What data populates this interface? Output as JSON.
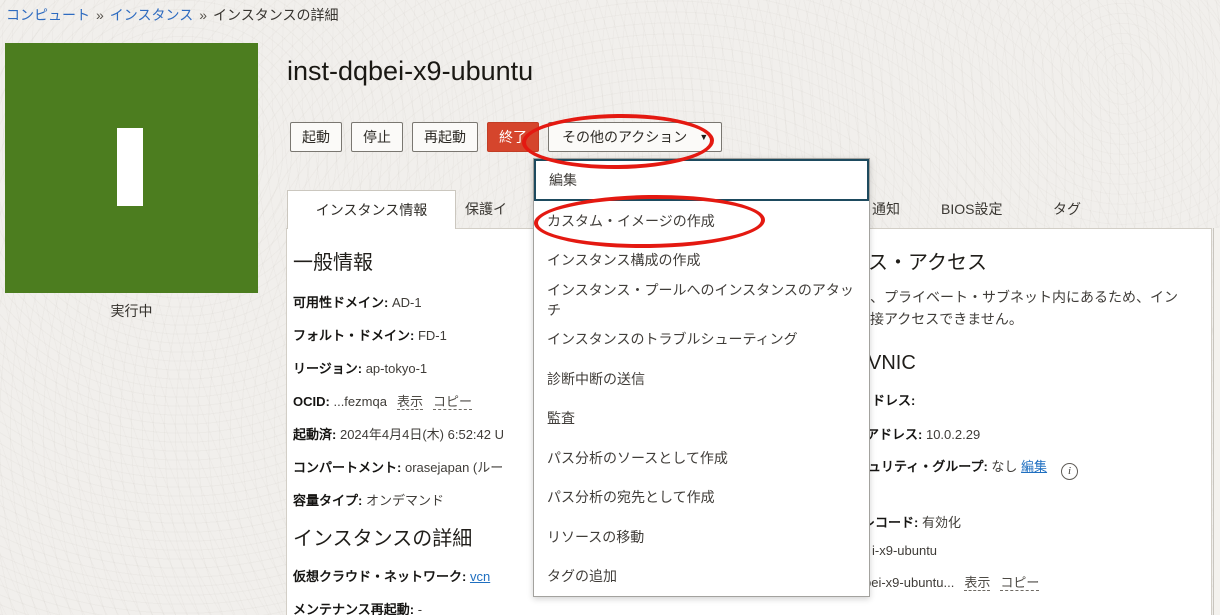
{
  "colors": {
    "background": "#f1efec",
    "status_running_green": "#4c7d1f",
    "danger_red": "#d5452c",
    "annotation_red": "#e41911",
    "link_blue": "#1f6fc0",
    "focus_teal": "#1d4a5e"
  },
  "breadcrumb": {
    "separator": "»",
    "items": [
      "コンピュート",
      "インスタンス",
      "インスタンスの詳細"
    ]
  },
  "status_tile": {
    "label": "実行中"
  },
  "header": {
    "title": "inst-dqbei-x9-ubuntu",
    "buttons": [
      "起動",
      "停止",
      "再起動",
      "終了"
    ],
    "more_actions": {
      "label": "その他のアクション",
      "caret": "▼"
    }
  },
  "tabs": {
    "active": "インスタンス情報",
    "clipped": "保護イ",
    "right": [
      "通知",
      "BIOS設定",
      "タグ"
    ]
  },
  "general_info": {
    "heading": "一般情報",
    "fields": [
      {
        "label": "可用性ドメイン:",
        "value": "AD-1"
      },
      {
        "label": "フォルト・ドメイン:",
        "value": "FD-1"
      },
      {
        "label": "リージョン:",
        "value": "ap-tokyo-1"
      },
      {
        "label": "OCID:",
        "value": "...fezmqa",
        "links": [
          "表示",
          "コピー"
        ]
      },
      {
        "label": "起動済:",
        "value": "2024年4月4日(木) 6:52:42 U"
      },
      {
        "label": "コンパートメント:",
        "value": "orasejapan (ルー"
      },
      {
        "label": "容量タイプ:",
        "value": "オンデマンド"
      }
    ]
  },
  "instance_details": {
    "heading": "インスタンスの詳細",
    "fields": [
      {
        "label": "仮想クラウド・ネットワーク:",
        "link": "vcn"
      },
      {
        "label": "メンテナンス再起動:",
        "value": "-"
      }
    ]
  },
  "right_column": {
    "access_heading_fragment": "ス・アクセス",
    "access_text_line1": "、プライベート・サブネット内にあるため、イン",
    "access_text_line2": "接アクセスできません。",
    "vnic_heading_fragment": "VNIC",
    "fields": [
      {
        "label": "ドレス:",
        "value": ""
      },
      {
        "label": "アドレス:",
        "value": "10.0.2.29"
      },
      {
        "label": "ュリティ・グループ:",
        "value": "なし",
        "link": "編集",
        "info_icon": "i"
      },
      {
        "label": "レコード:",
        "value": "有効化"
      },
      {
        "value": "i-x9-ubuntu"
      },
      {
        "value": "bei-x9-ubuntu...",
        "links": [
          "表示",
          "コピー"
        ]
      }
    ]
  },
  "menu": {
    "items": [
      "編集",
      "カスタム・イメージの作成",
      "インスタンス構成の作成",
      "インスタンス・プールへのインスタンスのアタッチ",
      "インスタンスのトラブルシューティング",
      "診断中断の送信",
      "監査",
      "パス分析のソースとして作成",
      "パス分析の宛先として作成",
      "リソースの移動",
      "タグの追加"
    ]
  }
}
